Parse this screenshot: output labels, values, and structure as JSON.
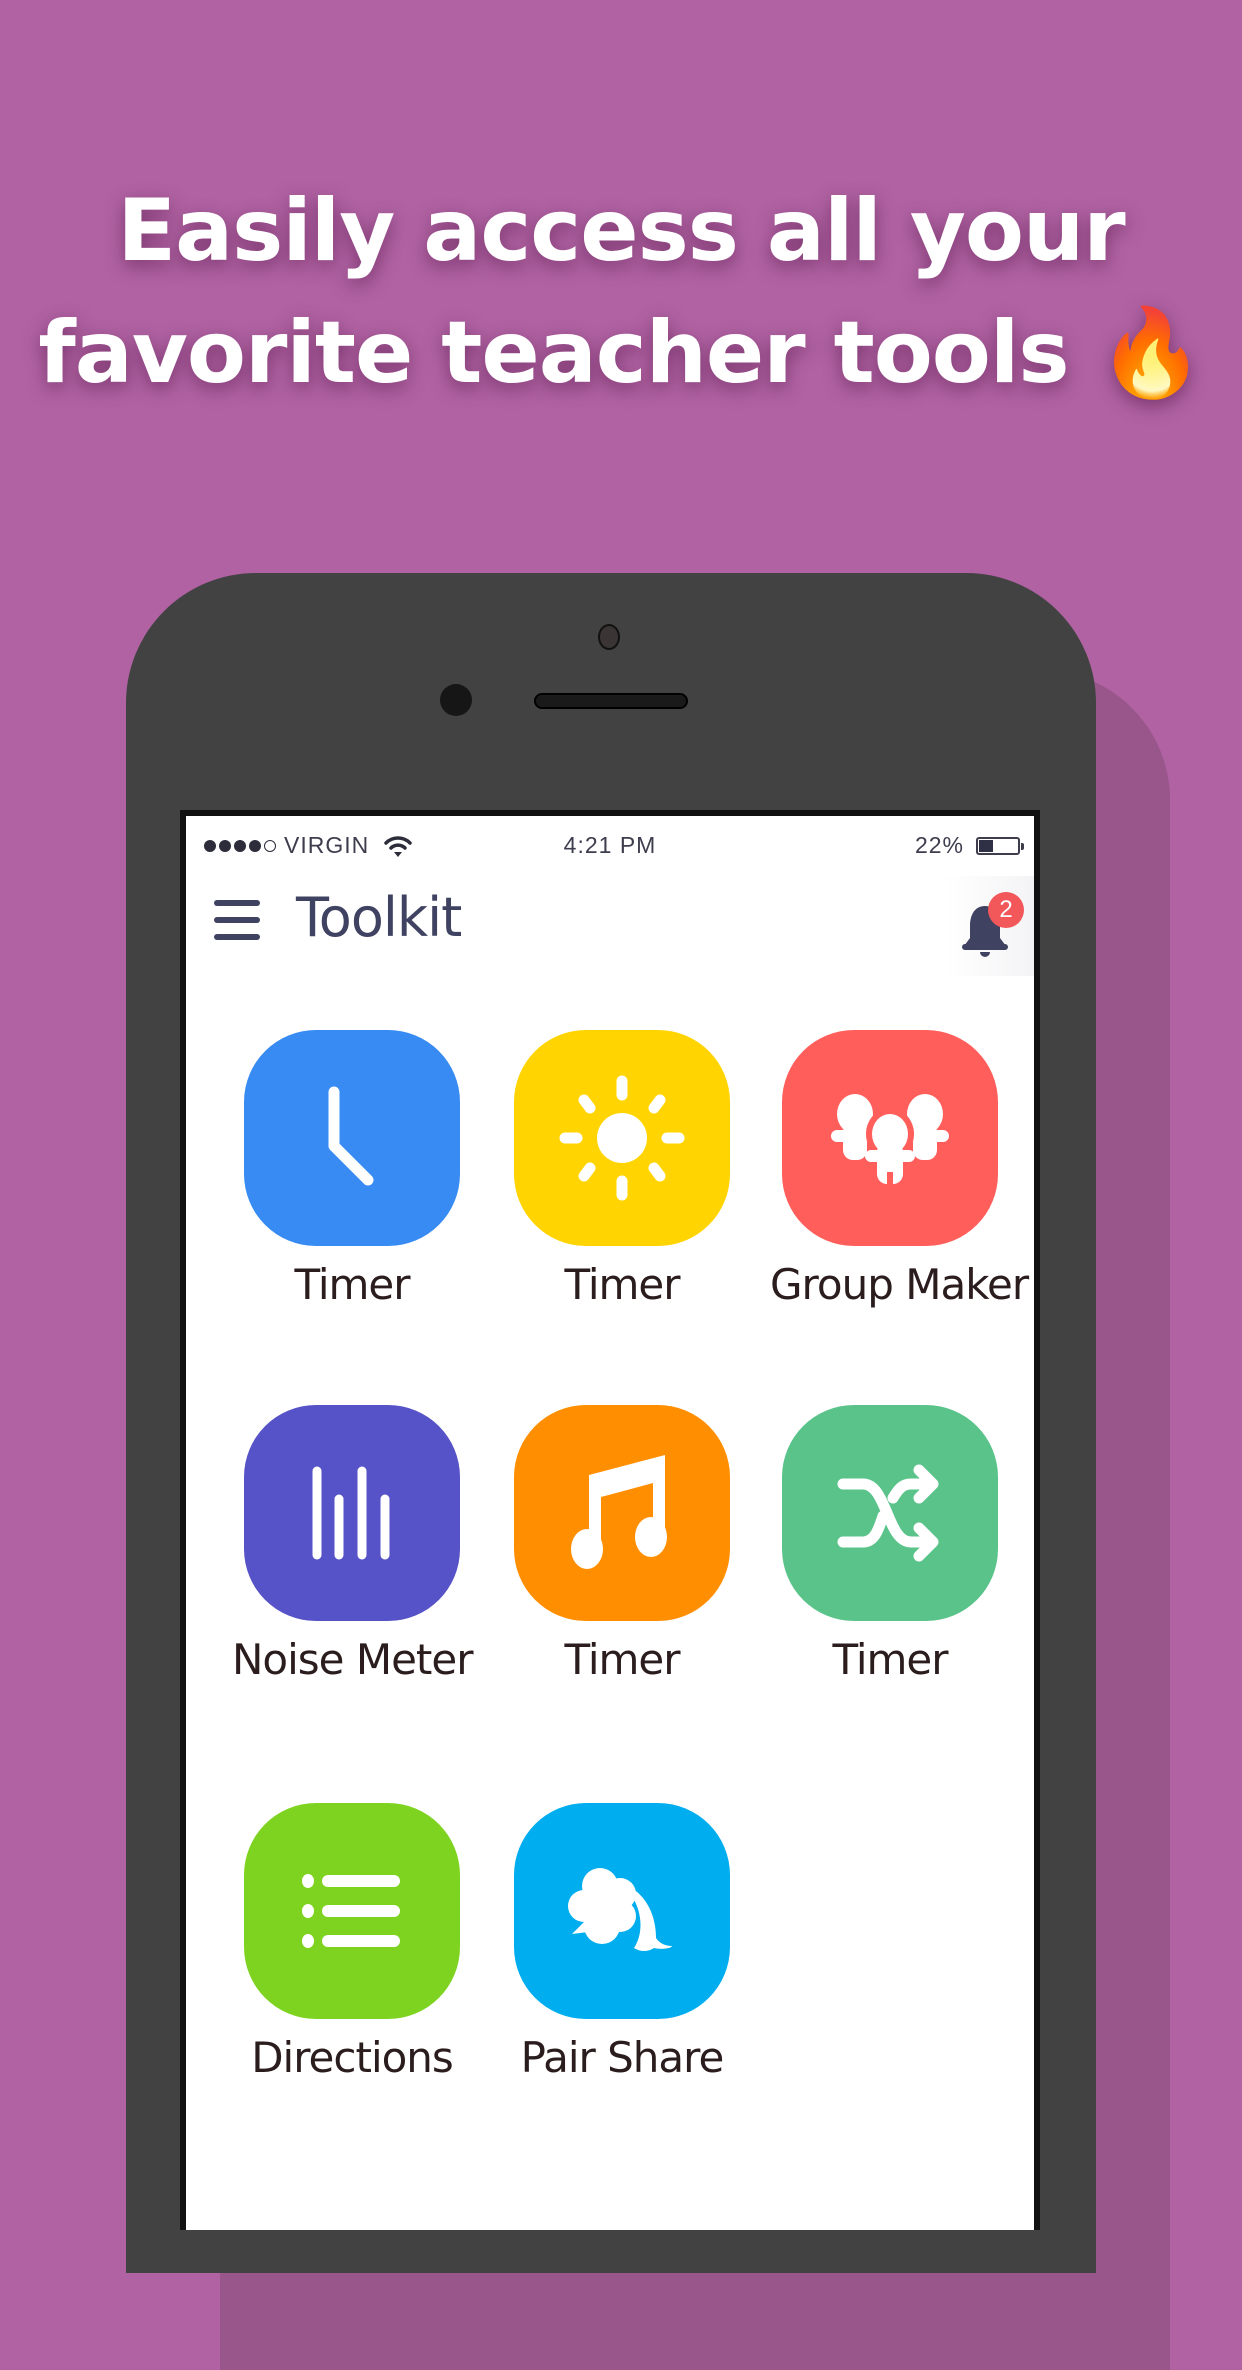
{
  "promo": {
    "headline_line1": "Easily access all your",
    "headline_line2": "favorite teacher tools",
    "emoji": "🔥",
    "background_color": "#B062A2"
  },
  "status_bar": {
    "signal_bars_filled": 4,
    "signal_bars_total": 5,
    "carrier": "VIRGIN",
    "time": "4:21 PM",
    "battery_percent_label": "22%",
    "battery_level": 0.22
  },
  "header": {
    "title": "Toolkit",
    "notification_count": "2"
  },
  "tools": [
    {
      "label": "Timer",
      "icon": "clock-icon",
      "color": "#378BF2"
    },
    {
      "label": "Timer",
      "icon": "sun-icon",
      "color": "#FFD400"
    },
    {
      "label": "Group Maker",
      "icon": "group-icon",
      "color": "#FF5E5B"
    },
    {
      "label": "Noise Meter",
      "icon": "bars-icon",
      "color": "#5652C7"
    },
    {
      "label": "Timer",
      "icon": "music-note-icon",
      "color": "#FF8F00"
    },
    {
      "label": "Timer",
      "icon": "shuffle-icon",
      "color": "#5AC38A"
    },
    {
      "label": "Directions",
      "icon": "list-icon",
      "color": "#7ED321"
    },
    {
      "label": "Pair Share",
      "icon": "chat-bubbles-icon",
      "color": "#00AEEF"
    }
  ]
}
